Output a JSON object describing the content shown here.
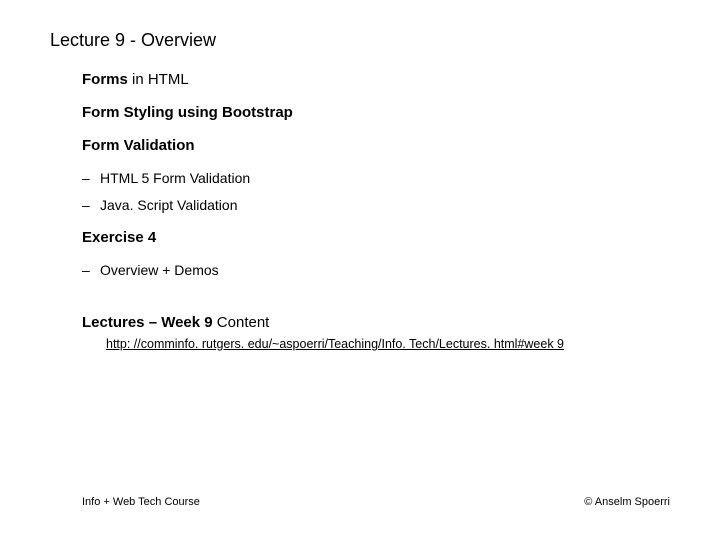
{
  "title": "Lecture 9 - Overview",
  "topics": {
    "forms_bold": "Forms",
    "forms_rest": " in HTML",
    "styling": "Form Styling using Bootstrap",
    "validation": "Form Validation",
    "exercise": "Exercise 4",
    "lectures_bold": "Lectures – Week 9",
    "lectures_rest": " Content"
  },
  "bullets": {
    "validation": [
      "HTML 5 Form Validation",
      "Java. Script Validation"
    ],
    "exercise": [
      "Overview + Demos"
    ]
  },
  "link": {
    "text": "http: //comminfo. rutgers. edu/~aspoerri/Teaching/Info. Tech/Lectures. html#week 9",
    "href": "http://comminfo.rutgers.edu/~aspoerri/Teaching/InfoTech/Lectures.html#week9"
  },
  "footer": {
    "left": "Info + Web Tech Course",
    "right": "© Anselm Spoerri"
  }
}
